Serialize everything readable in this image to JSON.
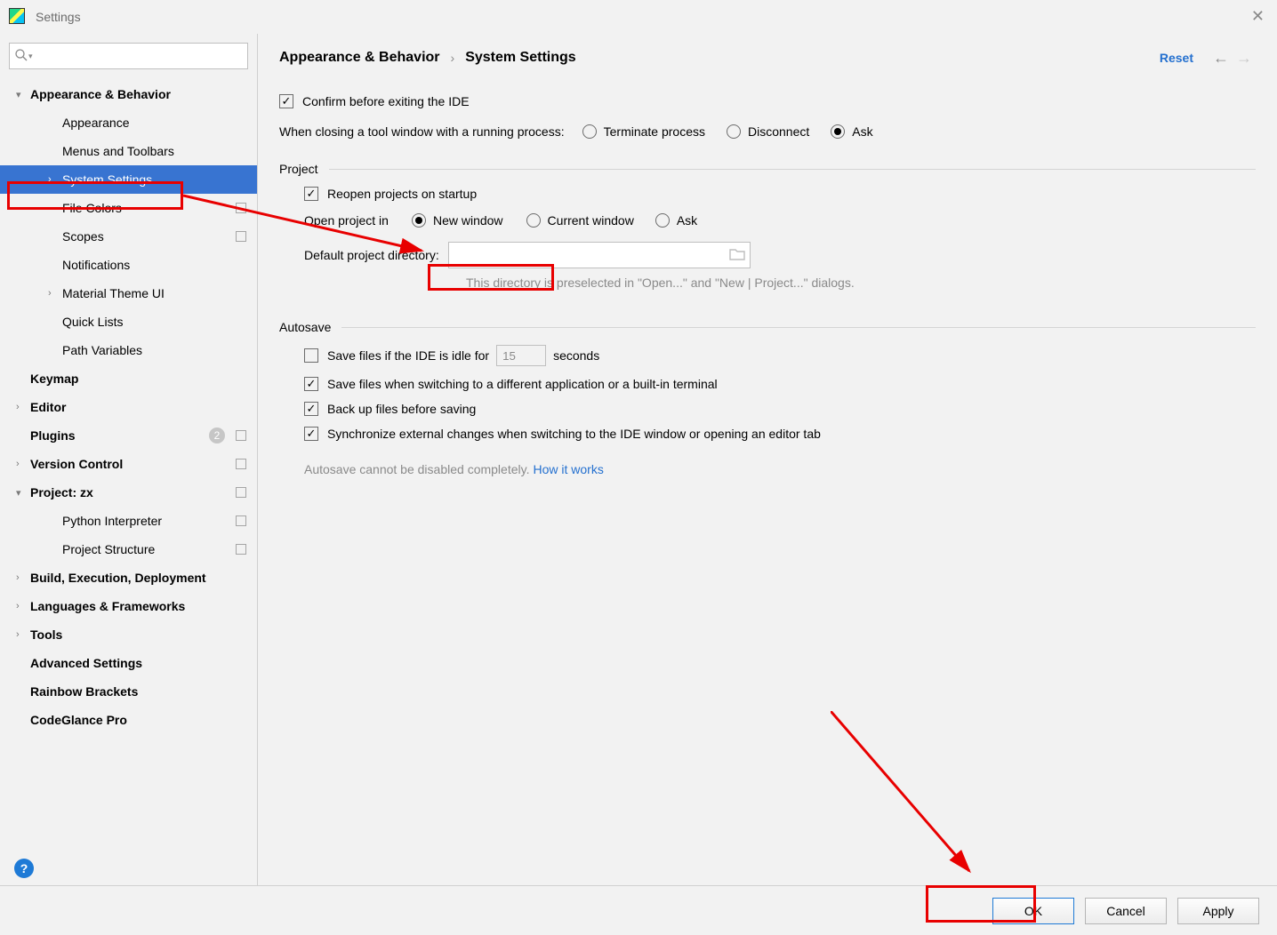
{
  "window": {
    "title": "Settings"
  },
  "search": {
    "placeholder": ""
  },
  "sidebar": {
    "items": [
      {
        "label": "Appearance & Behavior",
        "expand": "▾",
        "bold": true
      },
      {
        "label": "Appearance",
        "child": true
      },
      {
        "label": "Menus and Toolbars",
        "child": true
      },
      {
        "label": "System Settings",
        "expand": "›",
        "child": true,
        "selected": true
      },
      {
        "label": "File Colors",
        "child": true,
        "mark": true
      },
      {
        "label": "Scopes",
        "child": true,
        "mark": true
      },
      {
        "label": "Notifications",
        "child": true
      },
      {
        "label": "Material Theme UI",
        "expand": "›",
        "child": true
      },
      {
        "label": "Quick Lists",
        "child": true
      },
      {
        "label": "Path Variables",
        "child": true
      },
      {
        "label": "Keymap",
        "bold": true
      },
      {
        "label": "Editor",
        "expand": "›",
        "bold": true
      },
      {
        "label": "Plugins",
        "bold": true,
        "badge": "2",
        "mark": true
      },
      {
        "label": "Version Control",
        "expand": "›",
        "bold": true,
        "mark": true
      },
      {
        "label": "Project: zx",
        "expand": "▾",
        "bold": true,
        "mark": true
      },
      {
        "label": "Python Interpreter",
        "child": true,
        "mark": true
      },
      {
        "label": "Project Structure",
        "child": true,
        "mark": true
      },
      {
        "label": "Build, Execution, Deployment",
        "expand": "›",
        "bold": true
      },
      {
        "label": "Languages & Frameworks",
        "expand": "›",
        "bold": true
      },
      {
        "label": "Tools",
        "expand": "›",
        "bold": true
      },
      {
        "label": "Advanced Settings",
        "bold": true
      },
      {
        "label": "Rainbow Brackets",
        "bold": true
      },
      {
        "label": "CodeGlance Pro",
        "bold": true
      }
    ]
  },
  "breadcrumb": {
    "a": "Appearance & Behavior",
    "b": "System Settings"
  },
  "header": {
    "reset": "Reset"
  },
  "general": {
    "confirm_exit": "Confirm before exiting the IDE",
    "closing_label": "When closing a tool window with a running process:",
    "terminate": "Terminate process",
    "disconnect": "Disconnect",
    "ask": "Ask"
  },
  "project": {
    "title": "Project",
    "reopen": "Reopen projects on startup",
    "open_in_label": "Open project in",
    "new_window": "New window",
    "current_window": "Current window",
    "ask": "Ask",
    "dir_label": "Default project directory:",
    "dir_value": "",
    "dir_hint": "This directory is preselected in \"Open...\" and \"New | Project...\" dialogs."
  },
  "autosave": {
    "title": "Autosave",
    "idle_prefix": "Save files if the IDE is idle for",
    "idle_value": "15",
    "idle_suffix": "seconds",
    "switch": "Save files when switching to a different application or a built-in terminal",
    "backup": "Back up files before saving",
    "sync": "Synchronize external changes when switching to the IDE window or opening an editor tab",
    "note_a": "Autosave cannot be disabled completely. ",
    "note_link": "How it works"
  },
  "footer": {
    "ok": "OK",
    "cancel": "Cancel",
    "apply": "Apply"
  }
}
